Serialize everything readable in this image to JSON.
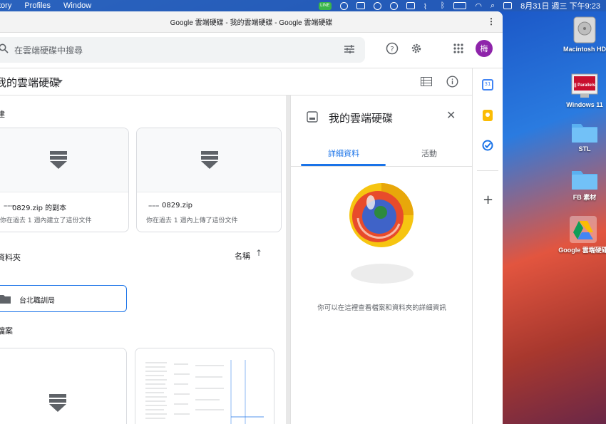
{
  "menubar": {
    "items": [
      "tory",
      "Profiles",
      "Window"
    ],
    "line_badge": "LINE",
    "clock": "8月31日 週三 下午9:23"
  },
  "window": {
    "title": "Google 雲端硬碟 - 我的雲端硬碟 - Google 雲端硬碟",
    "menu_label": "⋮"
  },
  "topbar": {
    "search_placeholder": "在雲端硬碟中搜尋",
    "avatar_initial": "梅"
  },
  "subbar": {
    "title": "我的雲端硬碟"
  },
  "main": {
    "suggested_label": "建",
    "files": [
      {
        "name": "0829.zip 的副本",
        "subtitle": "你在過去 1 週內建立了這份文件"
      },
      {
        "name": "0829.zip",
        "subtitle": "你在過去 1 週內上傳了這份文件"
      }
    ],
    "folders_label": "資料夾",
    "sort_label": "名稱",
    "folder_name": "台北職訓局",
    "files_label": "檔案"
  },
  "details": {
    "title": "我的雲端硬碟",
    "tabs": [
      "詳細資料",
      "活動"
    ],
    "active_tab": 0,
    "hint": "你可以在這裡查看檔案和資料夾的詳細資訊",
    "accent": "#1a73e8"
  },
  "sidepanel": {
    "calendar_day": "31",
    "icons": [
      "calendar-icon",
      "keep-icon",
      "tasks-icon",
      "add-icon"
    ]
  },
  "desktop": {
    "icons": [
      "Macintosh HD",
      "Windows 11",
      "STL",
      "FB 素材",
      "Google 雲端硬碟"
    ],
    "parallels_label": "|| Parallels"
  }
}
